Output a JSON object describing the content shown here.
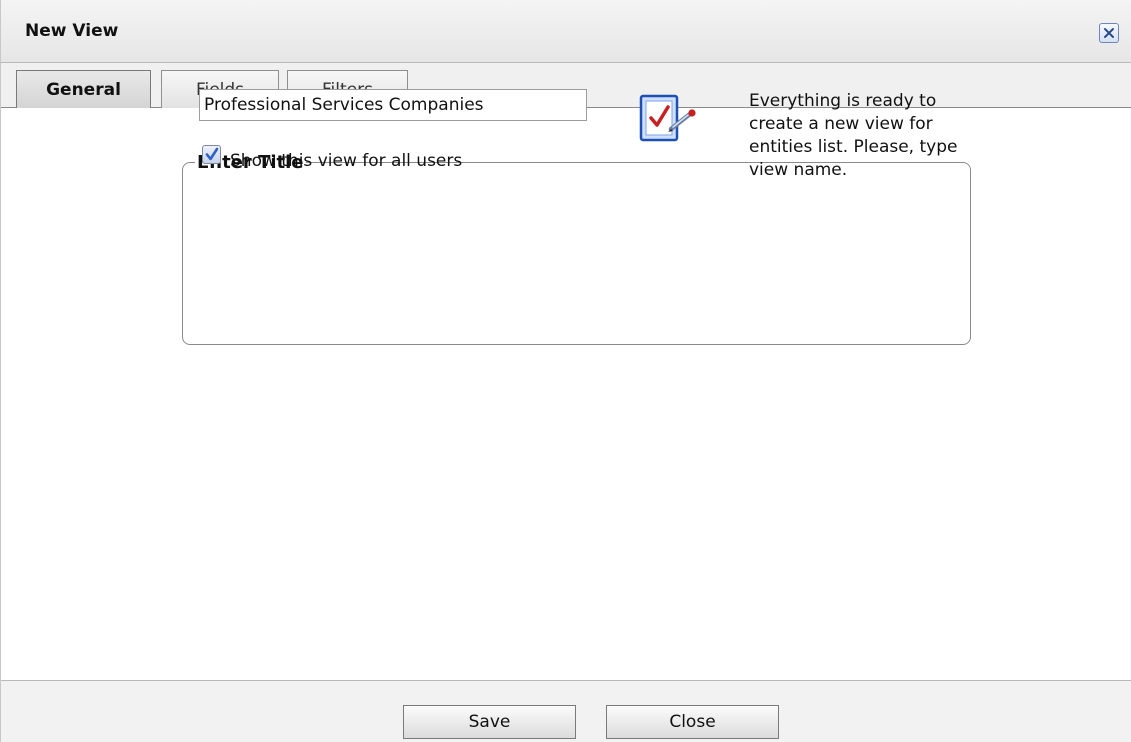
{
  "window": {
    "title": "New View",
    "close_icon": "close-icon"
  },
  "tabs": [
    {
      "label": "General",
      "active": true
    },
    {
      "label": "Fields",
      "active": false
    },
    {
      "label": "Filters",
      "active": false
    }
  ],
  "general": {
    "group_legend": "Enter Title",
    "title_value": "Professional Services Companies",
    "show_all_users": {
      "label": "Show this view for all users",
      "checked": true
    },
    "info_icon": "checklist-pencil-icon",
    "info_text": "Everything is ready to create a new view for entities list. Please, type view name."
  },
  "footer": {
    "save_label": "Save",
    "close_label": "Close"
  },
  "colors": {
    "accent_blue": "#2f63c8",
    "check_red": "#c82020"
  }
}
